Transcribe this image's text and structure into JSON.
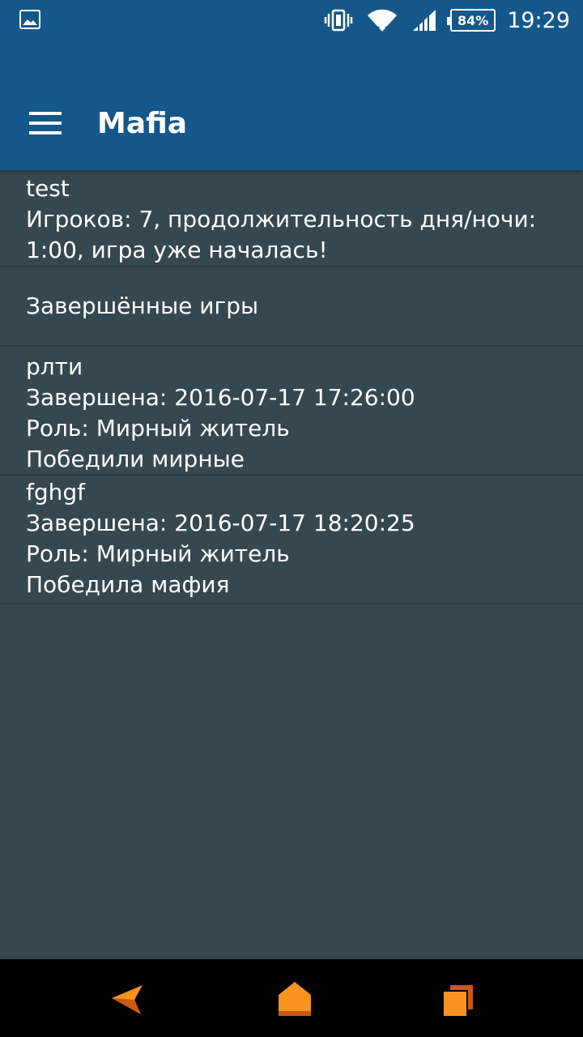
{
  "status_bar": {
    "battery": "84%",
    "time": "19:29",
    "icons": [
      "gallery-notification-icon",
      "vibrate-icon",
      "wifi-icon",
      "cell-signal-icon",
      "battery-icon"
    ]
  },
  "app_bar": {
    "title": "Mafia",
    "menu_icon": "hamburger-menu-icon"
  },
  "active_game": {
    "name": "test",
    "info_line1": "Игроков: 7, продолжительность дня/ночи:",
    "info_line2": "1:00, игра уже началась!"
  },
  "finished_header": "Завершённые игры",
  "finished_games": [
    {
      "name": "рлти",
      "finished": "Завершена: 2016-07-17 17:26:00",
      "role": "Роль: Мирный житель",
      "result": "Победили мирные"
    },
    {
      "name": "fghgf",
      "finished": "Завершена: 2016-07-17 18:20:25",
      "role": "Роль: Мирный житель",
      "result": "Победила мафия"
    }
  ],
  "nav_bar": {
    "icons": [
      "back-icon",
      "home-icon",
      "recents-icon"
    ],
    "accent": "#f7931e"
  },
  "colors": {
    "app_bar": "#14578a",
    "background": "#37474f"
  }
}
